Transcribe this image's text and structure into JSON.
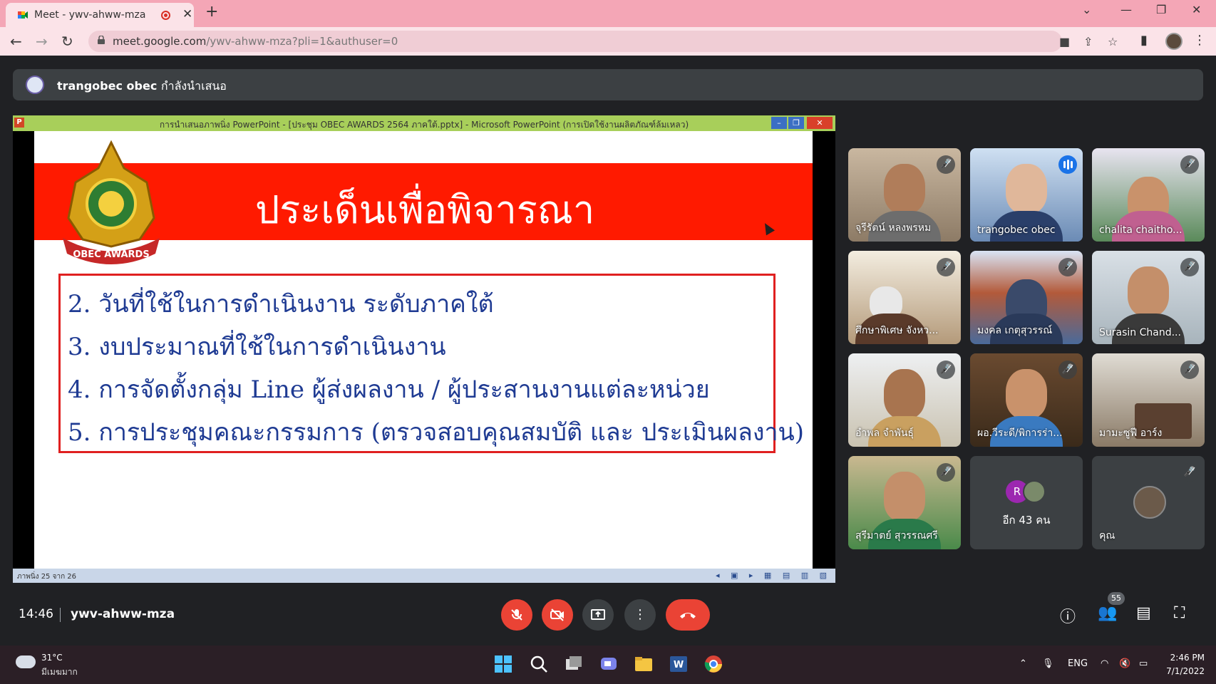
{
  "browser": {
    "tab_title": "Meet - ywv-ahww-mza",
    "tab_close": "✕",
    "new_tab": "+",
    "url_host": "meet.google.com",
    "url_path": "/ywv-ahww-mza?pli=1&authuser=0"
  },
  "meet": {
    "presenter_name": "trangobec obec",
    "presenter_status": "กำลังนำเสนอ",
    "clock": "14:46",
    "meeting_code": "ywv-ahww-mza",
    "participant_count": "55"
  },
  "ppt": {
    "window_title": "การนำเสนอภาพนิ่ง PowerPoint - [ประชุม OBEC AWARDS 2564 ภาคใต้.pptx] - Microsoft PowerPoint (การเปิดใช้งานผลิตภัณฑ์ล้มเหลว)",
    "slide_counter": "ภาพนิ่ง 25 จาก 26",
    "slide_heading": "ประเด็นเพื่อพิจารณา",
    "logo_text": "OBEC AWARDS",
    "items": [
      "2. วันที่ใช้ในการดำเนินงาน ระดับภาคใต้",
      "3. งบประมาณที่ใช้ในการดำเนินงาน",
      "4. การจัดตั้งกลุ่ม Line ผู้ส่งผลงาน / ผู้ประสานงานแต่ละหน่วย",
      "5. การประชุมคณะกรรมการ (ตรวจสอบคุณสมบัติ และ ประเมินผลงาน)"
    ]
  },
  "participants": [
    {
      "name": "จุรีรัตน์ หลงพรหม"
    },
    {
      "name": "trangobec obec"
    },
    {
      "name": "chalita chaitho..."
    },
    {
      "name": "ศึกษาพิเศษ จังหว..."
    },
    {
      "name": "มงคล เกตุสุวรรณ์"
    },
    {
      "name": "Surasin Chand..."
    },
    {
      "name": "อำพล จำพันธุ์"
    },
    {
      "name": "ผอ.วีระดี/พิการร่า..."
    },
    {
      "name": "มามะซูฟี อาร์ง"
    },
    {
      "name": "สุรีมาตย์ สุวรรณศรี"
    }
  ],
  "more_tile": {
    "avatar_letter": "R",
    "text": "อีก 43 คน"
  },
  "self_tile": {
    "name": "คุณ"
  },
  "taskbar": {
    "temperature": "31°C",
    "weather_desc": "มีเมฆมาก",
    "lang": "ENG",
    "time": "2:46 PM",
    "date": "7/1/2022"
  }
}
